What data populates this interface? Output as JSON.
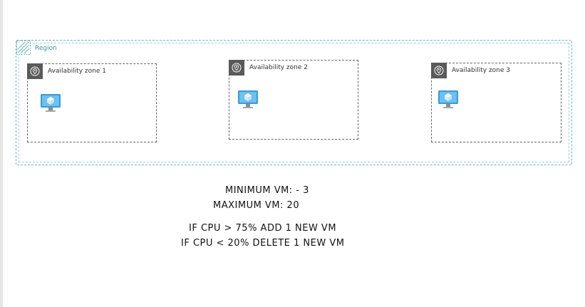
{
  "region": {
    "label": "Region"
  },
  "zones": [
    {
      "label": "Availability zone 1"
    },
    {
      "label": "Availability zone 2"
    },
    {
      "label": "Availability zone 3"
    }
  ],
  "icons": {
    "zone": "location-pin-icon",
    "vm": "virtual-machine-icon",
    "region": "region-hatch-icon"
  },
  "colors": {
    "region_border": "#6fb3bd",
    "zone_badge": "#5a5a5a",
    "vm_blue": "#3c9ad6"
  },
  "notes": {
    "min_vm": "MINIMUM VM: - 3",
    "max_vm": "MAXIMUM VM: 20",
    "rule_add": "IF CPU > 75% ADD 1 NEW VM",
    "rule_delete": "IF CPU < 20% DELETE 1 NEW VM"
  }
}
